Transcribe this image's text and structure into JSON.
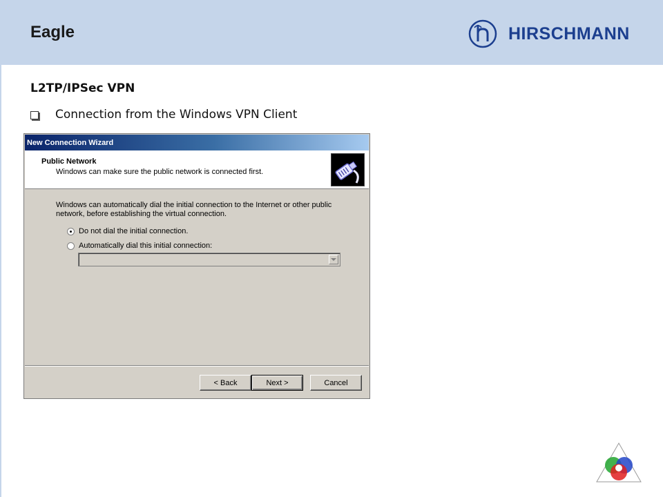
{
  "slide": {
    "title": "Eagle",
    "brand": "HIRSCHMANN",
    "section_heading": "L2TP/IPSec VPN",
    "bullet": "Connection from the Windows VPN Client"
  },
  "dialog": {
    "window_title": "New Connection Wizard",
    "header_title": "Public Network",
    "header_subtitle": "Windows can make sure the public network is connected first.",
    "header_icon": "network-cable-icon",
    "body_line1": "Windows can automatically dial the initial connection to the Internet or other public",
    "body_line2": "network, before establishing the virtual connection.",
    "option_no_dial": "Do not dial the initial connection.",
    "option_auto_dial": "Automatically dial this initial connection:",
    "selected_option": "option_no_dial",
    "combo_value": "",
    "back_label": "< Back",
    "next_label": "Next >",
    "cancel_label": "Cancel"
  },
  "colors": {
    "header_band": "#c5d5ea",
    "brand": "#1c3f8f",
    "dialog_face": "#d4d0c8",
    "titlebar_start": "#0a246a",
    "titlebar_end": "#a6caf0"
  }
}
